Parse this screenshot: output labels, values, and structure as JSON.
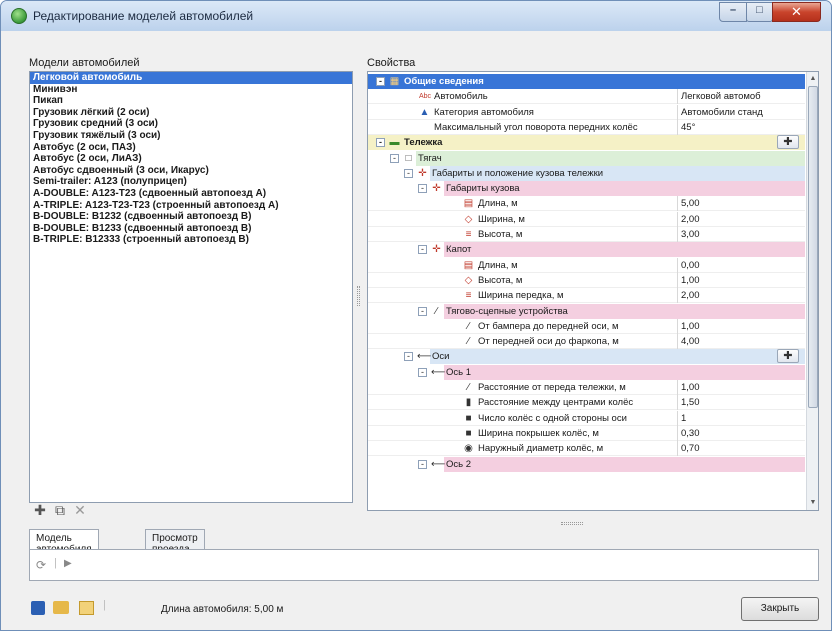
{
  "window": {
    "title": "Редактирование моделей автомобилей"
  },
  "models": {
    "label": "Модели автомобилей",
    "items": [
      "Легковой автомобиль",
      "Минивэн",
      "Пикап",
      "Грузовик лёгкий (2 оси)",
      "Грузовик средний (3 оси)",
      "Грузовик тяжёлый (3 оси)",
      "Автобус (2 оси, ПАЗ)",
      "Автобус (2 оси, ЛиАЗ)",
      "Автобус сдвоенный (3 оси, Икарус)",
      "Semi-trailer: A123 (полуприцеп)",
      "A-DOUBLE: A123-T23 (сдвоенный автопоезд А)",
      "A-TRIPLE: A123-T23-T23 (строенный автопоезд А)",
      "B-DOUBLE: B1232 (сдвоенный автопоезд B)",
      "B-DOUBLE: B1233 (сдвоенный автопоезд B)",
      "B-TRIPLE: B12333 (строенный автопоезд B)"
    ],
    "selected_index": 0
  },
  "props": {
    "label": "Свойства",
    "rows": [
      {
        "label": "Общие сведения",
        "value": "",
        "style": "group-blue"
      },
      {
        "label": "Автомобиль",
        "value": "Легковой автомоб"
      },
      {
        "label": "Категория автомобиля",
        "value": "Автомобили станд"
      },
      {
        "label": "Максимальный угол поворота передних колёс",
        "value": "45°"
      },
      {
        "label": "Тележка",
        "value": "",
        "style": "group-yellow"
      },
      {
        "label": "Тягач",
        "value": "",
        "style": "sub-green"
      },
      {
        "label": "Габариты и положение кузова тележки",
        "value": "",
        "style": "sub-blue"
      },
      {
        "label": "Габариты кузова",
        "value": "",
        "style": "sub-pink"
      },
      {
        "label": "Длина, м",
        "value": "5,00"
      },
      {
        "label": "Ширина, м",
        "value": "2,00"
      },
      {
        "label": "Высота, м",
        "value": "3,00"
      },
      {
        "label": "Капот",
        "value": "",
        "style": "sub-pink"
      },
      {
        "label": "Длина, м",
        "value": "0,00"
      },
      {
        "label": "Высота, м",
        "value": "1,00"
      },
      {
        "label": "Ширина передка, м",
        "value": "2,00"
      },
      {
        "label": "Тягово-сцепные устройства",
        "value": "",
        "style": "sub-pink"
      },
      {
        "label": "От бампера до передней оси, м",
        "value": "1,00"
      },
      {
        "label": "От передней оси до фаркопа, м",
        "value": "4,00"
      },
      {
        "label": "Оси",
        "value": "",
        "style": "sub-blue"
      },
      {
        "label": "Ось 1",
        "value": "",
        "style": "sub-pink"
      },
      {
        "label": "Расстояние от переда тележки, м",
        "value": "1,00"
      },
      {
        "label": "Расстояние между центрами колёс",
        "value": "1,50"
      },
      {
        "label": "Число колёс с одной стороны оси",
        "value": "1"
      },
      {
        "label": "Ширина покрышек колёс, м",
        "value": "0,30"
      },
      {
        "label": "Наружный диаметр колёс, м",
        "value": "0,70"
      },
      {
        "label": "Ось 2",
        "value": "",
        "style": "sub-pink"
      }
    ]
  },
  "tabs": [
    "Модель автомобиля",
    "Просмотр проезда"
  ],
  "status": {
    "text": "Длина автомобиля: 5,00 м"
  },
  "buttons": {
    "close": "Закрыть"
  },
  "colors": {
    "selection": "#3875d7",
    "group_yellow": "#f5f1c6",
    "pink": "#f4cfe0",
    "light_blue": "#d8e6f5"
  }
}
